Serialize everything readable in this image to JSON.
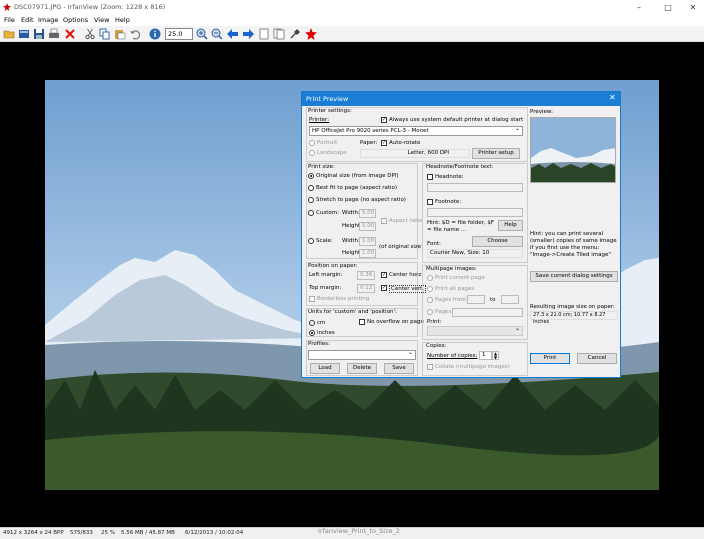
{
  "window": {
    "title": "DSC07971.JPG - IrfanView (Zoom: 1228 x 816)"
  },
  "menu": [
    "File",
    "Edit",
    "Image",
    "Options",
    "View",
    "Help"
  ],
  "toolbar": {
    "zoom_value": "25.0"
  },
  "status": {
    "dims": "4912 x 3264 x 24 BPP",
    "index": "575/833",
    "zoom": "25 %",
    "size": "5.56 MB / 45.87 MB",
    "datetime": "6/12/2013 / 10:02:04"
  },
  "caption": "Irfanview_Print_to_Size_2",
  "dialog": {
    "title": "Print Preview",
    "printer_settings": "Printer settings:",
    "printer_label": "Printer:",
    "use_default": "Always use system default printer at dialog start",
    "printer_name": "HP OfficeJet Pro 9020 series PCL-3 - Monet",
    "portrait": "Portrait",
    "landscape": "Landscape",
    "paper_label": "Paper:",
    "auto_rotate": "Auto-rotate",
    "paper_info": "Letter,   600 DPI",
    "printer_setup": "Printer setup",
    "print_size": "Print size:",
    "original_size": "Original size (from image DPI)",
    "best_fit": "Best fit to page (aspect ratio)",
    "stretch": "Stretch to page (no aspect ratio)",
    "custom": "Custom:",
    "width_label": "Width:",
    "height_label": "Height:",
    "custom_width": "5.00",
    "custom_height": "5.00",
    "aspect_ratio": "Aspect ratio",
    "scale": "Scale:",
    "scale_width": "1.00",
    "scale_height": "1.00",
    "of_original": "(of original size)",
    "position": "Position on paper:",
    "left_margin": "Left margin:",
    "left_value": "0.36",
    "center_horz": "Center horz.",
    "top_margin": "Top margin:",
    "top_value": "0.12",
    "center_vert": "Center vert.",
    "borderless": "Borderless printing",
    "units_label": "Units for 'custom' and 'position':",
    "cm": "cm",
    "inches": "inches",
    "no_overflow": "No overflow on page",
    "profiles": "Profiles:",
    "load": "Load",
    "delete": "Delete",
    "save": "Save",
    "headnote_footnote": "Headnote/Footnote text:",
    "headnote": "Headnote:",
    "footnote": "Footnote:",
    "hint_text": "Hint: $D = file folder, $F = file name ...",
    "help": "Help",
    "font_label": "Font:",
    "choose": "Choose",
    "font_value": "Courier New, Size: 10",
    "multipage": "Multipage images:",
    "print_current": "Print current page",
    "print_all": "Print all pages",
    "pages_from": "Pages from:",
    "to": "to",
    "pages": "Pages:",
    "print_label": "Print:",
    "copies": "Copies:",
    "num_copies": "Number of copies:",
    "copies_value": "1",
    "collate": "Collate (multipage images)",
    "preview": "Preview:",
    "hint_small": "Hint: you can print several (smaller) copies of same image if you first use the menu: \"Image->Create Tiled image\"",
    "save_current": "Save current dialog settings",
    "resulting_label": "Resulting image size on paper:",
    "resulting_value": "27.3 x 21.0 cm; 10.77 x 8.27 inches",
    "print_btn": "Print",
    "cancel_btn": "Cancel"
  }
}
